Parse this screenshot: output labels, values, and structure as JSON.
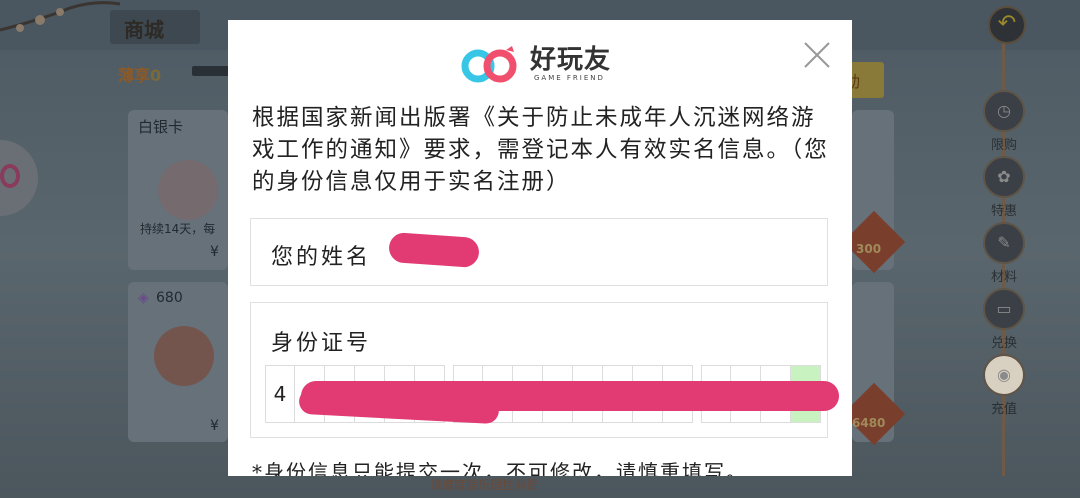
{
  "background": {
    "shop_title": "商城",
    "currency_label": "薄享",
    "currency_value": "0",
    "card1": {
      "name": "白银卡",
      "duration": "持续14天，每",
      "price": "¥"
    },
    "card2": {
      "cost": "680",
      "price": "¥"
    },
    "right_prices": [
      "300",
      "6480"
    ],
    "bottom_tip": "请遵度娱乐理性消费",
    "side_menu": [
      {
        "label": "限购",
        "icon": "clock-icon"
      },
      {
        "label": "特惠",
        "icon": "bag-icon"
      },
      {
        "label": "材料",
        "icon": "scroll-icon"
      },
      {
        "label": "兑换",
        "icon": "ticket-icon"
      },
      {
        "label": "充值",
        "icon": "money-bag-icon"
      }
    ],
    "back_icon": "back-arrow-icon"
  },
  "dialog": {
    "logo": {
      "name": "好玩友",
      "tagline": "GAME FRIEND"
    },
    "notice": "根据国家新闻出版署《关于防止未成年人沉迷网络游戏工作的通知》要求，需登记本人有效实名信息。（您的身份信息仅用于实名注册）",
    "name_field": {
      "label": "您的姓名",
      "value": ""
    },
    "id_field": {
      "label": "身份证号",
      "groups": [
        6,
        8,
        4
      ],
      "first_digit": "4"
    },
    "warning": "*身份信息只能提交一次，不可修改，请慎重填写。"
  },
  "colors": {
    "redaction": "#e23a72",
    "active_cell": "#c8f2c0",
    "logo_pink": "#f0506e",
    "logo_cyan": "#38c6e6"
  }
}
